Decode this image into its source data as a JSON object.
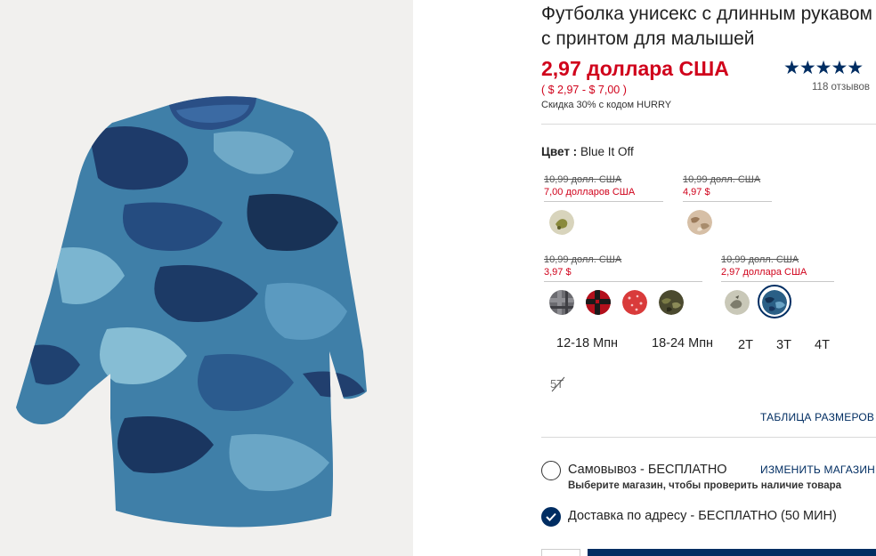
{
  "product": {
    "title": "Футболка унисекс с длинным рукавом с принтом для малышей",
    "price": "2,97 доллара США",
    "price_range": "( $ 2,97 - $ 7,00 )",
    "promo": "Скидка 30% с кодом HURRY",
    "rating_stars": "★★★★★",
    "reviews": "118 отзывов"
  },
  "color": {
    "label": "Цвет :",
    "value": "Blue It Off"
  },
  "price_groups": [
    {
      "old": "10,99 долл. США",
      "new": "7,00 долларов США"
    },
    {
      "old": "10,99 долл. США",
      "new": "4,97 $"
    },
    {
      "old": "10,99 долл. США",
      "new": "3,97 $"
    },
    {
      "old": "10,99 долл. США",
      "new": "2,97 доллара США"
    }
  ],
  "swatches": [
    {
      "name": "dino-green",
      "color": "#c9c3a4"
    },
    {
      "name": "camo-beige",
      "color": "#d6bfa6"
    },
    {
      "name": "gray-plaid",
      "color": "#6b6b70"
    },
    {
      "name": "red-plaid",
      "color": "#b3101c"
    },
    {
      "name": "red-dots",
      "color": "#d93b3b"
    },
    {
      "name": "green-camo",
      "color": "#4b4a2f"
    },
    {
      "name": "gray-dino",
      "color": "#b7b6a5"
    },
    {
      "name": "blue-camo",
      "color": "#2a5f86"
    }
  ],
  "sizes": [
    "12-18 Мпн",
    "18-24 Мпн",
    "2T",
    "3T",
    "4T",
    "5T"
  ],
  "size_chart": "ТАБЛИЦА РАЗМЕРОВ",
  "fulfillment": {
    "pickup_label": "Самовывоз - БЕСПЛАТНО",
    "pickup_sub": "Выберите магазин, чтобы проверить наличие товара",
    "change_store": "ИЗМЕНИТЬ МАГАЗИН",
    "ship_label": "Доставка по адресу - БЕСПЛАТНО (50 МИН)"
  }
}
